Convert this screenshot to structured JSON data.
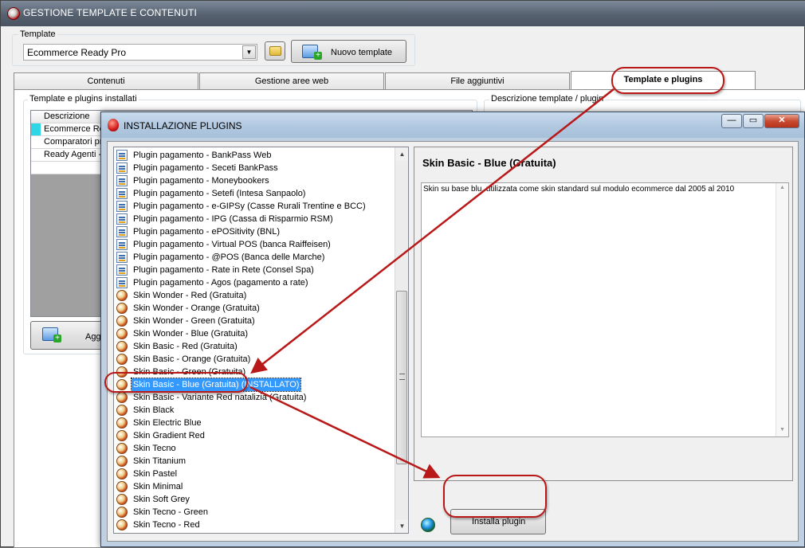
{
  "main": {
    "title": "GESTIONE TEMPLATE E CONTENUTI",
    "template_label": "Template",
    "template_value": "Ecommerce Ready Pro",
    "new_template_label": "Nuovo template",
    "tabs": [
      {
        "label": "Contenuti"
      },
      {
        "label": "Gestione aree web"
      },
      {
        "label": "File aggiuntivi"
      },
      {
        "label": "Template e plugins"
      }
    ],
    "installed_group_label": "Template e plugins installati",
    "desc_group_label": "Descrizione template / plugin",
    "grid_header": "Descrizione",
    "grid_rows": [
      "Ecommerce Re",
      "Comparatori pre",
      "Ready Agenti -"
    ],
    "add_button_label": "Agg"
  },
  "dialog": {
    "title": "INSTALLAZIONE PLUGINS",
    "plugins": [
      {
        "label": "Plugin pagamento - BankPass Web",
        "icon": "document-icon"
      },
      {
        "label": "Plugin pagamento - Seceti BankPass",
        "icon": "document-icon"
      },
      {
        "label": "Plugin pagamento - Moneybookers",
        "icon": "document-icon"
      },
      {
        "label": "Plugin pagamento - Setefi (Intesa Sanpaolo)",
        "icon": "document-icon"
      },
      {
        "label": "Plugin pagamento - e-GIPSy (Casse Rurali Trentine e BCC)",
        "icon": "document-icon"
      },
      {
        "label": "Plugin pagamento - IPG (Cassa di Risparmio RSM)",
        "icon": "document-icon"
      },
      {
        "label": "Plugin pagamento - ePOSitivity (BNL)",
        "icon": "document-icon"
      },
      {
        "label": "Plugin pagamento - Virtual POS (banca Raiffeisen)",
        "icon": "document-icon"
      },
      {
        "label": "Plugin pagamento - @POS (Banca delle Marche)",
        "icon": "document-icon"
      },
      {
        "label": "Plugin pagamento - Rate in Rete (Consel Spa)",
        "icon": "document-icon"
      },
      {
        "label": "Plugin pagamento - Agos (pagamento a rate)",
        "icon": "document-icon"
      },
      {
        "label": "Skin Wonder - Red (Gratuita)",
        "icon": "skin-icon"
      },
      {
        "label": "Skin Wonder - Orange (Gratuita)",
        "icon": "skin-icon"
      },
      {
        "label": "Skin Wonder - Green (Gratuita)",
        "icon": "skin-icon"
      },
      {
        "label": "Skin Wonder - Blue (Gratuita)",
        "icon": "skin-icon"
      },
      {
        "label": "Skin Basic - Red (Gratuita)",
        "icon": "skin-icon"
      },
      {
        "label": "Skin Basic - Orange (Gratuita)",
        "icon": "skin-icon"
      },
      {
        "label": "Skin Basic - Green (Gratuita)",
        "icon": "skin-icon"
      },
      {
        "label": "Skin Basic - Blue (Gratuita) (INSTALLATO)",
        "icon": "skin-icon",
        "selected": true
      },
      {
        "label": "Skin Basic - Variante Red natalizia (Gratuita)",
        "icon": "skin-icon"
      },
      {
        "label": "Skin Black",
        "icon": "skin-icon"
      },
      {
        "label": "Skin Electric Blue",
        "icon": "skin-icon"
      },
      {
        "label": "Skin Gradient Red",
        "icon": "skin-icon"
      },
      {
        "label": "Skin Tecno",
        "icon": "skin-icon"
      },
      {
        "label": "Skin Titanium",
        "icon": "skin-icon"
      },
      {
        "label": "Skin Pastel",
        "icon": "skin-icon"
      },
      {
        "label": "Skin Minimal",
        "icon": "skin-icon"
      },
      {
        "label": "Skin Soft Grey",
        "icon": "skin-icon"
      },
      {
        "label": "Skin Tecno - Green",
        "icon": "skin-icon"
      },
      {
        "label": "Skin Tecno - Red",
        "icon": "skin-icon"
      }
    ],
    "selected_title": "Skin Basic - Blue (Gratuita)",
    "selected_description": "Skin su base blu, utilizzata come skin standard sul modulo ecommerce dal 2005 al 2010",
    "install_button_label": "Installa plugin",
    "caption_buttons": {
      "minimize": "—",
      "maximize": "▭",
      "close": "✕"
    }
  },
  "colors": {
    "annotation": "#b81818",
    "selection": "#3399ff"
  }
}
